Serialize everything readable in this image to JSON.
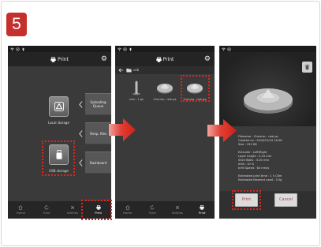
{
  "step": {
    "number": "5"
  },
  "colors": {
    "step_badge": "#c5302c",
    "highlight": "#e0251b",
    "arrow": "#d21f16",
    "screen_header": "#242424",
    "screen_content": "#3a3a3a",
    "button": "#dcdcdc"
  },
  "screens": [
    {
      "status_icons": [
        "wifi-status-icon",
        "network-status-icon",
        "upload-status-icon"
      ],
      "header": {
        "title": "Print",
        "title_icon": "printer-icon",
        "settings_icon": "gear-icon"
      },
      "storage": [
        {
          "label": "Local storage",
          "icon": "local-storage-icon"
        },
        {
          "label": "USB storage",
          "icon": "usb-icon",
          "highlighted": true
        }
      ],
      "side_menu": [
        {
          "label": "Uploading Queue",
          "icon": "chevron-left-icon"
        },
        {
          "label": "Temp. files",
          "icon": "chevron-left-icon"
        },
        {
          "label": "Dashboard",
          "icon": "chevron-left-icon"
        }
      ],
      "nav": [
        {
          "label": "Home",
          "icon": "home-icon"
        },
        {
          "label": "Tune",
          "icon": "tune-icon"
        },
        {
          "label": "Utilities",
          "icon": "utilities-icon"
        },
        {
          "label": "Print",
          "icon": "print-icon",
          "active": true,
          "highlighted": true
        }
      ]
    },
    {
      "status_icons": [
        "wifi-status-icon",
        "network-status-icon",
        "upload-status-icon"
      ],
      "header": {
        "title": "Print",
        "title_icon": "printer-icon",
        "settings_icon": "gear-icon"
      },
      "breadcrumb": {
        "back_icon": "back-arrow-icon",
        "folder_icon": "folder-icon",
        "path": "usb"
      },
      "files": [
        {
          "name": "sam...1.gx",
          "icon": "model-thumbnail-icon"
        },
        {
          "name": "Charma...real.gx",
          "icon": "model-thumbnail-icon"
        },
        {
          "name": "Charma...real.gx",
          "icon": "model-thumbnail-icon",
          "highlighted": true
        }
      ],
      "nav": [
        {
          "label": "Home",
          "icon": "home-icon"
        },
        {
          "label": "Tune",
          "icon": "tune-icon"
        },
        {
          "label": "Utilities",
          "icon": "utilities-icon"
        },
        {
          "label": "Print",
          "icon": "print-icon",
          "active": true
        }
      ]
    },
    {
      "status_icons": [
        "wifi-status-icon",
        "network-status-icon"
      ],
      "preview": {
        "delete_icon": "trash-icon",
        "model_icon": "model-preview-icon"
      },
      "file_info": {
        "details": [
          "Filename : Charma... real.gx",
          "Created on : 2018/12/24 14:06",
          "Size : 252 KB"
        ],
        "settings": [
          "Extruder : Left/Right",
          "Layer height : 0.20 mm",
          "Shell Walls : 3.00 mm",
          "Infill : 10 %",
          "Infill Speed : 60 mm/s"
        ],
        "estimates": [
          "Estimated print time : 1 h 03m",
          "Estimated filament used : 3.5g"
        ]
      },
      "buttons": {
        "print": "Print",
        "cancel": "Cancel",
        "print_highlighted": true
      }
    }
  ]
}
